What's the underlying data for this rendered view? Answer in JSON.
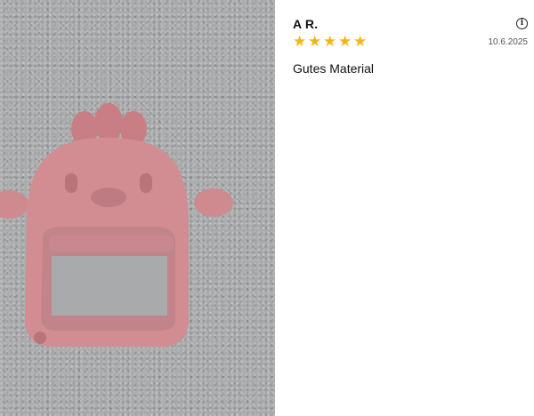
{
  "photo": {
    "icon": "teether-photo"
  },
  "review": {
    "author": "A R.",
    "info_icon": "i",
    "rating": 5,
    "rating_max": 5,
    "star_glyph": "★",
    "star_color": "#f3b51a",
    "date": "10.6.2025",
    "title": "Gutes Material"
  }
}
